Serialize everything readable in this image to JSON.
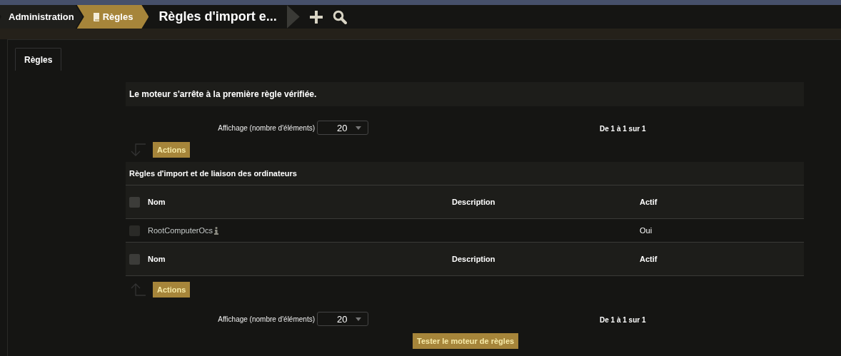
{
  "breadcrumbs": [
    {
      "label": "Administration",
      "selected": false,
      "kind": "plain"
    },
    {
      "label": "Règles",
      "selected": true,
      "kind": "book"
    }
  ],
  "page_title": "Règles d'import e...",
  "toolbar": [
    {
      "kind": "add"
    },
    {
      "kind": "search"
    }
  ],
  "tabs": [
    {
      "label": "Règles",
      "selected": true
    }
  ],
  "notice": "Le moteur s'arrête à la première règle vérifiée.",
  "pager_top": {
    "label": "Affichage (nombre d'éléments)",
    "value": "20",
    "range": "De 1 à 1 sur 1"
  },
  "actions_top": {
    "label": "Actions",
    "kind": "down"
  },
  "table": {
    "caption": "Règles d'import et de liaison des ordinateurs",
    "columns": [
      "Nom",
      "Description",
      "Actif"
    ],
    "header_checked": false,
    "rows": [
      {
        "name": "RootComputerOcs",
        "active": "Oui",
        "checked": false
      }
    ],
    "footer_columns": [
      "Nom",
      "Description",
      "Actif"
    ],
    "footer_checked": false
  },
  "actions_bottom": {
    "label": "Actions",
    "kind": "up"
  },
  "pager_bottom": {
    "label": "Affichage (nombre d'éléments)",
    "value": "20",
    "range": "De 1 à 1 sur 1"
  },
  "test_button": "Tester le moteur de règles"
}
